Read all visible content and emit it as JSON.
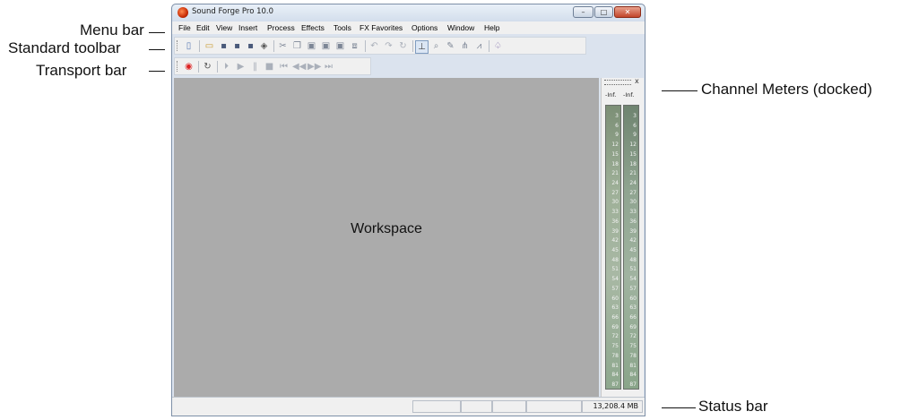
{
  "callouts": {
    "menu_bar": "Menu bar",
    "standard_toolbar": "Standard toolbar",
    "transport_bar": "Transport bar",
    "channel_meters": "Channel Meters (docked)",
    "status_bar": "Status bar"
  },
  "window": {
    "title": "Sound Forge Pro 10.0",
    "controls": {
      "minimize": "–",
      "maximize": "□",
      "close": "✕"
    }
  },
  "menu": [
    "File",
    "Edit",
    "View",
    "Insert",
    "Process",
    "Effects",
    "Tools",
    "FX Favorites",
    "Options",
    "Window",
    "Help"
  ],
  "standard_toolbar": {
    "icons": [
      "new-icon",
      "open-icon",
      "save-icon",
      "save-as-icon",
      "save-all-icon",
      "render-icon",
      "cut-icon",
      "copy-icon",
      "paste-icon",
      "paste-special-icon",
      "mix-icon",
      "crop-icon",
      "undo-icon",
      "redo-icon",
      "repeat-icon",
      "edit-tool-icon",
      "magnify-tool-icon",
      "pencil-tool-icon",
      "envelope-tool-icon",
      "event-tool-icon",
      "properties-icon"
    ]
  },
  "transport_bar": {
    "icons": [
      "record-icon",
      "loop-icon",
      "play-all-icon",
      "play-icon",
      "pause-icon",
      "stop-icon",
      "go-to-start-icon",
      "rewind-icon",
      "fast-forward-icon",
      "go-to-end-icon"
    ]
  },
  "workspace": {
    "label": "Workspace"
  },
  "meters": {
    "close": "x",
    "peak_left": "-Inf.",
    "peak_right": "-Inf.",
    "scale": [
      "3",
      "6",
      "9",
      "12",
      "15",
      "18",
      "21",
      "24",
      "27",
      "30",
      "33",
      "36",
      "39",
      "42",
      "45",
      "48",
      "51",
      "54",
      "57",
      "60",
      "63",
      "66",
      "69",
      "72",
      "75",
      "78",
      "81",
      "84",
      "87"
    ]
  },
  "status": {
    "memory": "13,208.4 MB"
  }
}
